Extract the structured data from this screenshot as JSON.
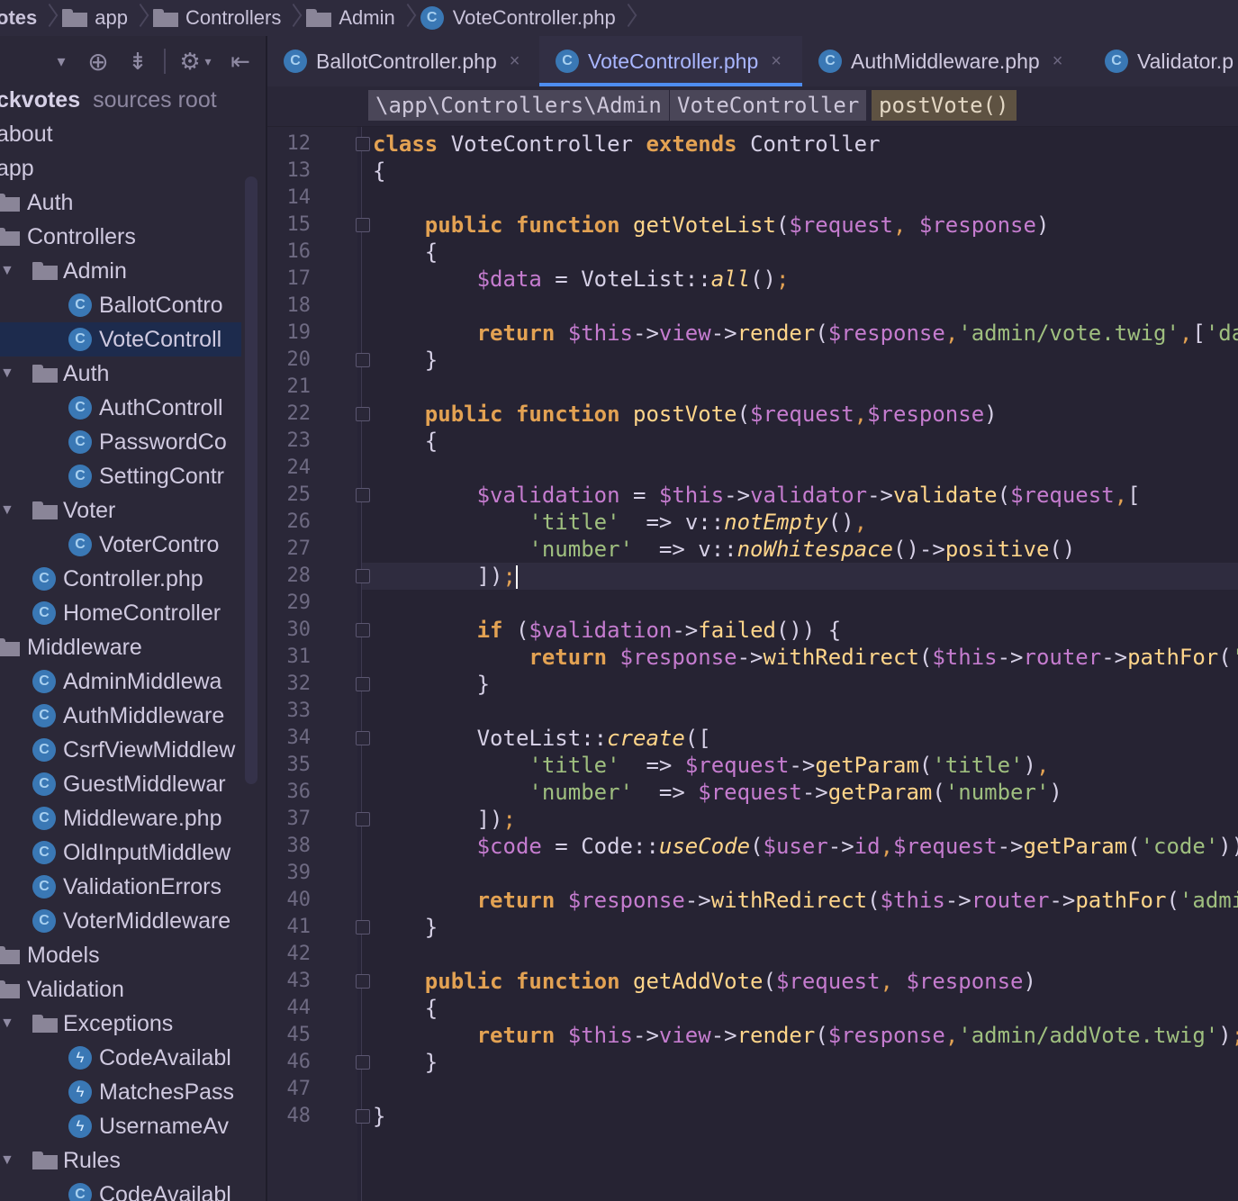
{
  "breadcrumb": [
    {
      "label": "otes",
      "icon": "none"
    },
    {
      "label": "app",
      "icon": "folder-icon"
    },
    {
      "label": "Controllers",
      "icon": "folder-icon"
    },
    {
      "label": "Admin",
      "icon": "folder-icon"
    },
    {
      "label": "VoteController.php",
      "icon": "php-class-icon"
    }
  ],
  "toolbar": {
    "collapse_glyph": "▾",
    "target_glyph": "⊕",
    "split_glyph": "⇟",
    "gear_glyph": "⚙",
    "gear_menu_glyph": "▾",
    "hide_glyph": "⇤"
  },
  "tree": {
    "root": {
      "name": "ckvotes",
      "suffix": "sources root"
    },
    "items": [
      {
        "label": "about"
      },
      {
        "label": "app"
      },
      {
        "label": "Auth"
      },
      {
        "label": "Controllers"
      },
      {
        "label": "Admin"
      },
      {
        "label": "BallotContro"
      },
      {
        "label": "VoteControll"
      },
      {
        "label": "Auth"
      },
      {
        "label": "AuthControll"
      },
      {
        "label": "PasswordCo"
      },
      {
        "label": "SettingContr"
      },
      {
        "label": "Voter"
      },
      {
        "label": "VoterContro"
      },
      {
        "label": "Controller.php"
      },
      {
        "label": "HomeController"
      },
      {
        "label": "Middleware"
      },
      {
        "label": "AdminMiddlewa"
      },
      {
        "label": "AuthMiddleware"
      },
      {
        "label": "CsrfViewMiddlew"
      },
      {
        "label": "GuestMiddlewar"
      },
      {
        "label": "Middleware.php"
      },
      {
        "label": "OldInputMiddlew"
      },
      {
        "label": "ValidationErrors"
      },
      {
        "label": "VoterMiddleware"
      },
      {
        "label": "Models"
      },
      {
        "label": "Validation"
      },
      {
        "label": "Exceptions"
      },
      {
        "label": "CodeAvailabl"
      },
      {
        "label": "MatchesPass"
      },
      {
        "label": "UsernameAv"
      },
      {
        "label": "Rules"
      },
      {
        "label": "CodeAvailabl"
      }
    ]
  },
  "tabs": [
    {
      "label": "BallotController.php",
      "active": false,
      "close": "×"
    },
    {
      "label": "VoteController.php",
      "active": true,
      "close": "×"
    },
    {
      "label": "AuthMiddleware.php",
      "active": false,
      "close": "×"
    },
    {
      "label": "Validator.p",
      "active": false,
      "close": ""
    }
  ],
  "editor_breadcrumb": [
    "\\app\\Controllers\\Admin",
    "VoteController",
    "postVote()"
  ],
  "editor": {
    "line_numbers": [
      "12",
      "13",
      "14",
      "15",
      "16",
      "17",
      "18",
      "19",
      "20",
      "21",
      "22",
      "23",
      "24",
      "25",
      "26",
      "27",
      "28",
      "29",
      "30",
      "31",
      "32",
      "33",
      "34",
      "35",
      "36",
      "37",
      "38",
      "39",
      "40",
      "41",
      "42",
      "43",
      "44",
      "45",
      "46",
      "47",
      "48"
    ],
    "current_line": "28",
    "code_lines": [
      "class VoteController extends Controller",
      "{",
      "",
      "    public function getVoteList($request, $response)",
      "    {",
      "        $data = VoteList::all();",
      "",
      "        return $this->view->render($response,'admin/vote.twig',['data",
      "    }",
      "",
      "    public function postVote($request,$response)",
      "    {",
      "",
      "        $validation = $this->validator->validate($request,[",
      "            'title'  => v::notEmpty(),",
      "            'number'  => v::noWhitespace()->positive()",
      "        ]);",
      "",
      "        if ($validation->failed()) {",
      "            return $response->withRedirect($this->router->pathFor('ac",
      "        }",
      "",
      "        VoteList::create([",
      "            'title'  => $request->getParam('title'),",
      "            'number'  => $request->getParam('number')",
      "        ]);",
      "        $code = Code::useCode($user->id,$request->getParam('code'));",
      "",
      "        return $response->withRedirect($this->router->pathFor('admin.",
      "    }",
      "",
      "    public function getAddVote($request, $response)",
      "    {",
      "        return $this->view->render($response,'admin/addVote.twig');",
      "    }",
      "",
      "}"
    ]
  },
  "colors": {
    "keyword": "#e3a253",
    "variable": "#c57ccf",
    "string": "#9fbf7f",
    "function": "#ffd58a",
    "text": "#d6d0e6",
    "accent": "#4e8df0",
    "class_icon": "#3a78b5",
    "selection": "#1d2b4d"
  }
}
